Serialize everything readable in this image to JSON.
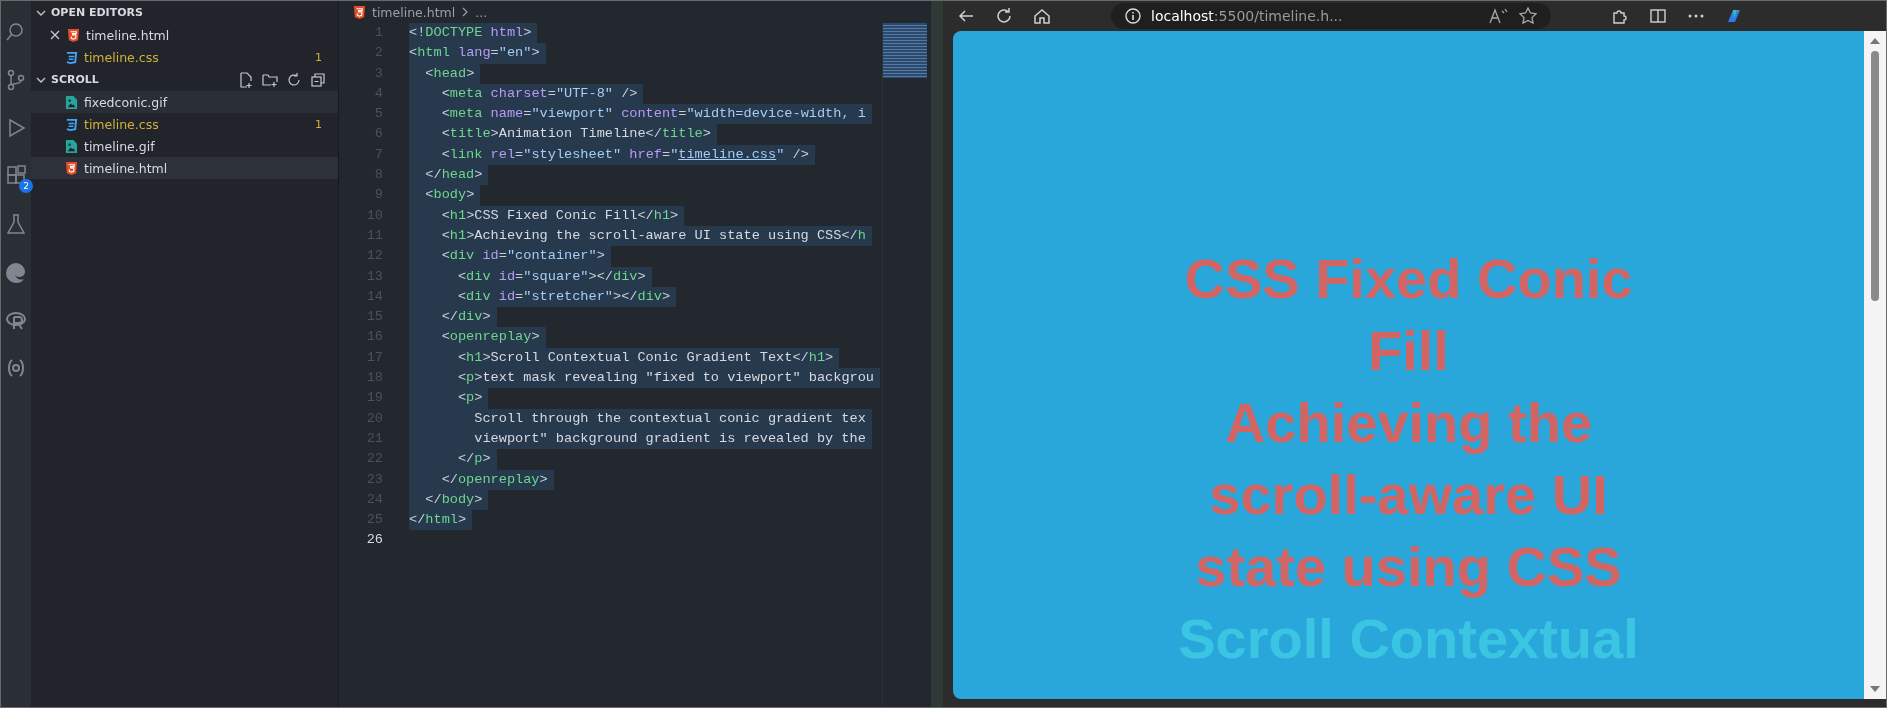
{
  "activity_bar": {
    "items": [
      {
        "kind": "search"
      },
      {
        "kind": "source-control"
      },
      {
        "kind": "run"
      },
      {
        "kind": "extensions",
        "badge": "2"
      },
      {
        "kind": "testing"
      },
      {
        "kind": "browser"
      },
      {
        "kind": "r"
      },
      {
        "kind": "brackets"
      }
    ]
  },
  "explorer": {
    "open_editors": {
      "title": "OPEN EDITORS",
      "expanded": true,
      "items": [
        {
          "name": "timeline.html",
          "kind": "html",
          "active": true,
          "warning": false
        },
        {
          "name": "timeline.css",
          "kind": "css",
          "active": false,
          "warning": true,
          "badge": "1"
        }
      ]
    },
    "folder": {
      "title": "SCROLL",
      "expanded": true,
      "items": [
        {
          "name": "fixedconic.gif",
          "kind": "image",
          "selected": false,
          "hovered": true,
          "warning": false
        },
        {
          "name": "timeline.css",
          "kind": "css",
          "selected": false,
          "hovered": false,
          "warning": true,
          "badge": "1"
        },
        {
          "name": "timeline.gif",
          "kind": "image",
          "selected": false,
          "hovered": false,
          "warning": false
        },
        {
          "name": "timeline.html",
          "kind": "html",
          "selected": true,
          "hovered": false,
          "warning": false
        }
      ]
    }
  },
  "editor": {
    "breadcrumb": {
      "file": "timeline.html",
      "rest": "..."
    },
    "lines": [
      {
        "number": "1",
        "selected": true,
        "current": false,
        "tokens": [
          {
            "kind": "punct",
            "text": "<!"
          },
          {
            "kind": "tag",
            "text": "DOCTYPE"
          },
          {
            "kind": "attr",
            "text": " html"
          },
          {
            "kind": "punct",
            "text": ">"
          }
        ]
      },
      {
        "number": "2",
        "selected": true,
        "current": false,
        "tokens": [
          {
            "kind": "punct",
            "text": "<"
          },
          {
            "kind": "tag",
            "text": "html"
          },
          {
            "kind": "attr",
            "text": " lang"
          },
          {
            "kind": "punct",
            "text": "="
          },
          {
            "kind": "string",
            "text": "\"en\""
          },
          {
            "kind": "punct",
            "text": ">"
          }
        ]
      },
      {
        "number": "3",
        "selected": true,
        "current": false,
        "tokens": [
          {
            "kind": "punct",
            "text": "  <"
          },
          {
            "kind": "tag",
            "text": "head"
          },
          {
            "kind": "punct",
            "text": ">"
          }
        ]
      },
      {
        "number": "4",
        "selected": true,
        "current": false,
        "tokens": [
          {
            "kind": "punct",
            "text": "    <"
          },
          {
            "kind": "tag",
            "text": "meta"
          },
          {
            "kind": "attr",
            "text": " charset"
          },
          {
            "kind": "punct",
            "text": "="
          },
          {
            "kind": "string",
            "text": "\"UTF-8\""
          },
          {
            "kind": "punct",
            "text": " />"
          }
        ]
      },
      {
        "number": "5",
        "selected": true,
        "current": false,
        "tokens": [
          {
            "kind": "punct",
            "text": "    <"
          },
          {
            "kind": "tag",
            "text": "meta"
          },
          {
            "kind": "attr",
            "text": " name"
          },
          {
            "kind": "punct",
            "text": "="
          },
          {
            "kind": "string",
            "text": "\"viewport\""
          },
          {
            "kind": "attr",
            "text": " content"
          },
          {
            "kind": "punct",
            "text": "="
          },
          {
            "kind": "string",
            "text": "\"width=device-width, i"
          }
        ]
      },
      {
        "number": "6",
        "selected": true,
        "current": false,
        "tokens": [
          {
            "kind": "punct",
            "text": "    <"
          },
          {
            "kind": "tag",
            "text": "title"
          },
          {
            "kind": "punct",
            "text": ">"
          },
          {
            "kind": "text",
            "text": "Animation Timeline"
          },
          {
            "kind": "punct",
            "text": "</"
          },
          {
            "kind": "tag",
            "text": "title"
          },
          {
            "kind": "punct",
            "text": ">"
          }
        ]
      },
      {
        "number": "7",
        "selected": true,
        "current": false,
        "tokens": [
          {
            "kind": "punct",
            "text": "    <"
          },
          {
            "kind": "tag",
            "text": "link"
          },
          {
            "kind": "attr",
            "text": " rel"
          },
          {
            "kind": "punct",
            "text": "="
          },
          {
            "kind": "string",
            "text": "\"stylesheet\""
          },
          {
            "kind": "attr",
            "text": " href"
          },
          {
            "kind": "punct",
            "text": "="
          },
          {
            "kind": "string",
            "text": "\""
          },
          {
            "kind": "link",
            "text": "timeline.css"
          },
          {
            "kind": "string",
            "text": "\""
          },
          {
            "kind": "punct",
            "text": " />"
          }
        ]
      },
      {
        "number": "8",
        "selected": true,
        "current": false,
        "tokens": [
          {
            "kind": "punct",
            "text": "  </"
          },
          {
            "kind": "tag",
            "text": "head"
          },
          {
            "kind": "punct",
            "text": ">"
          }
        ]
      },
      {
        "number": "9",
        "selected": true,
        "current": false,
        "tokens": [
          {
            "kind": "punct",
            "text": "  <"
          },
          {
            "kind": "tag",
            "text": "body"
          },
          {
            "kind": "punct",
            "text": ">"
          }
        ]
      },
      {
        "number": "10",
        "selected": true,
        "current": false,
        "tokens": [
          {
            "kind": "punct",
            "text": "    <"
          },
          {
            "kind": "tag",
            "text": "h1"
          },
          {
            "kind": "punct",
            "text": ">"
          },
          {
            "kind": "text",
            "text": "CSS Fixed Conic Fill"
          },
          {
            "kind": "punct",
            "text": "</"
          },
          {
            "kind": "tag",
            "text": "h1"
          },
          {
            "kind": "punct",
            "text": ">"
          }
        ]
      },
      {
        "number": "11",
        "selected": true,
        "current": false,
        "tokens": [
          {
            "kind": "punct",
            "text": "    <"
          },
          {
            "kind": "tag",
            "text": "h1"
          },
          {
            "kind": "punct",
            "text": ">"
          },
          {
            "kind": "text",
            "text": "Achieving the scroll-aware UI state using CSS"
          },
          {
            "kind": "punct",
            "text": "</"
          },
          {
            "kind": "tag",
            "text": "h"
          }
        ]
      },
      {
        "number": "12",
        "selected": true,
        "current": false,
        "tokens": [
          {
            "kind": "punct",
            "text": "    <"
          },
          {
            "kind": "tag",
            "text": "div"
          },
          {
            "kind": "attr",
            "text": " id"
          },
          {
            "kind": "punct",
            "text": "="
          },
          {
            "kind": "string",
            "text": "\"container\""
          },
          {
            "kind": "punct",
            "text": ">"
          }
        ]
      },
      {
        "number": "13",
        "selected": true,
        "current": false,
        "tokens": [
          {
            "kind": "punct",
            "text": "      <"
          },
          {
            "kind": "tag",
            "text": "div"
          },
          {
            "kind": "attr",
            "text": " id"
          },
          {
            "kind": "punct",
            "text": "="
          },
          {
            "kind": "string",
            "text": "\"square\""
          },
          {
            "kind": "punct",
            "text": "></"
          },
          {
            "kind": "tag",
            "text": "div"
          },
          {
            "kind": "punct",
            "text": ">"
          }
        ]
      },
      {
        "number": "14",
        "selected": true,
        "current": false,
        "tokens": [
          {
            "kind": "punct",
            "text": "      <"
          },
          {
            "kind": "tag",
            "text": "div"
          },
          {
            "kind": "attr",
            "text": " id"
          },
          {
            "kind": "punct",
            "text": "="
          },
          {
            "kind": "string",
            "text": "\"stretcher\""
          },
          {
            "kind": "punct",
            "text": "></"
          },
          {
            "kind": "tag",
            "text": "div"
          },
          {
            "kind": "punct",
            "text": ">"
          }
        ]
      },
      {
        "number": "15",
        "selected": true,
        "current": false,
        "tokens": [
          {
            "kind": "punct",
            "text": "    </"
          },
          {
            "kind": "tag",
            "text": "div"
          },
          {
            "kind": "punct",
            "text": ">"
          }
        ]
      },
      {
        "number": "16",
        "selected": true,
        "current": false,
        "tokens": [
          {
            "kind": "punct",
            "text": "    <"
          },
          {
            "kind": "tag",
            "text": "openreplay"
          },
          {
            "kind": "punct",
            "text": ">"
          }
        ]
      },
      {
        "number": "17",
        "selected": true,
        "current": false,
        "tokens": [
          {
            "kind": "punct",
            "text": "      <"
          },
          {
            "kind": "tag",
            "text": "h1"
          },
          {
            "kind": "punct",
            "text": ">"
          },
          {
            "kind": "text",
            "text": "Scroll Contextual Conic Gradient Text"
          },
          {
            "kind": "punct",
            "text": "</"
          },
          {
            "kind": "tag",
            "text": "h1"
          },
          {
            "kind": "punct",
            "text": ">"
          }
        ]
      },
      {
        "number": "18",
        "selected": true,
        "current": false,
        "tokens": [
          {
            "kind": "punct",
            "text": "      <"
          },
          {
            "kind": "tag",
            "text": "p"
          },
          {
            "kind": "punct",
            "text": ">"
          },
          {
            "kind": "text",
            "text": "text mask revealing \"fixed to viewport\" backgrou"
          }
        ]
      },
      {
        "number": "19",
        "selected": true,
        "current": false,
        "tokens": [
          {
            "kind": "punct",
            "text": "      <"
          },
          {
            "kind": "tag",
            "text": "p"
          },
          {
            "kind": "punct",
            "text": ">"
          }
        ]
      },
      {
        "number": "20",
        "selected": true,
        "current": false,
        "tokens": [
          {
            "kind": "text",
            "text": "        Scroll through the contextual conic gradient tex"
          }
        ]
      },
      {
        "number": "21",
        "selected": true,
        "current": false,
        "tokens": [
          {
            "kind": "text",
            "text": "        viewport\" background gradient is revealed by the"
          }
        ]
      },
      {
        "number": "22",
        "selected": true,
        "current": false,
        "tokens": [
          {
            "kind": "punct",
            "text": "      </"
          },
          {
            "kind": "tag",
            "text": "p"
          },
          {
            "kind": "punct",
            "text": ">"
          }
        ]
      },
      {
        "number": "23",
        "selected": true,
        "current": false,
        "tokens": [
          {
            "kind": "punct",
            "text": "    </"
          },
          {
            "kind": "tag",
            "text": "openreplay"
          },
          {
            "kind": "punct",
            "text": ">"
          }
        ]
      },
      {
        "number": "24",
        "selected": true,
        "current": false,
        "tokens": [
          {
            "kind": "punct",
            "text": "  </"
          },
          {
            "kind": "tag",
            "text": "body"
          },
          {
            "kind": "punct",
            "text": ">"
          }
        ]
      },
      {
        "number": "25",
        "selected": true,
        "current": false,
        "tokens": [
          {
            "kind": "punct",
            "text": "</"
          },
          {
            "kind": "tag",
            "text": "html"
          },
          {
            "kind": "punct",
            "text": ">"
          }
        ]
      },
      {
        "number": "26",
        "current": true
      }
    ]
  },
  "browser": {
    "address": {
      "host": "localhost",
      "rest": ":5500/timeline.h..."
    },
    "page": {
      "headings": [
        {
          "text": "CSS Fixed Conic Fill",
          "kind": "solid"
        },
        {
          "text": "Achieving the scroll-aware UI state using CSS",
          "kind": "solid"
        },
        {
          "text": "Scroll Contextual",
          "kind": "gradient"
        }
      ]
    }
  }
}
